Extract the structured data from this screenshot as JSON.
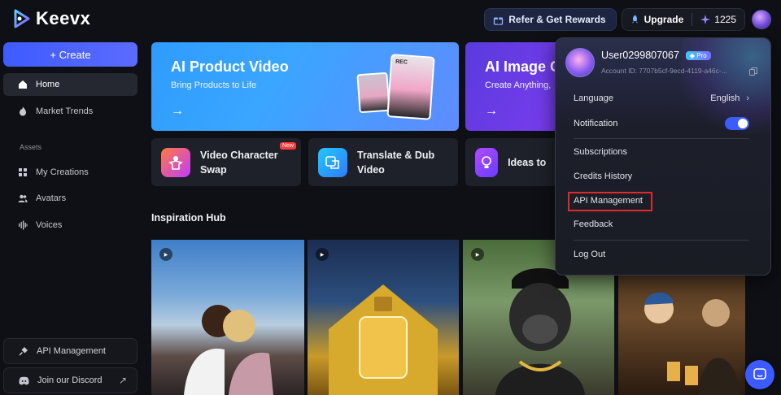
{
  "app": {
    "name": "Keevx"
  },
  "topbar": {
    "refer_label": "Refer & Get Rewards",
    "upgrade_label": "Upgrade",
    "credits": "1225"
  },
  "sidebar": {
    "create_label": "+ Create",
    "items": [
      {
        "label": "Home",
        "icon": "home-icon",
        "active": true
      },
      {
        "label": "Market Trends",
        "icon": "flame-icon",
        "active": false
      }
    ],
    "section_label": "Assets",
    "asset_items": [
      {
        "label": "My Creations",
        "icon": "grid-icon"
      },
      {
        "label": "Avatars",
        "icon": "users-icon"
      },
      {
        "label": "Voices",
        "icon": "waveform-icon"
      }
    ],
    "api_label": "API Management",
    "discord_label": "Join our Discord"
  },
  "main": {
    "hero_cards": [
      {
        "title": "AI Product Video",
        "subtitle": "Bring Products to Life",
        "arrow": "→",
        "photo_tag": "REC"
      },
      {
        "title": "AI Image G",
        "subtitle": "Create Anything,",
        "arrow": "→"
      }
    ],
    "tools": [
      {
        "label": "Video Character Swap",
        "badge": "New"
      },
      {
        "label": "Translate & Dub Video"
      },
      {
        "label": "Ideas to"
      }
    ],
    "hub_title": "Inspiration Hub"
  },
  "user_menu": {
    "username": "User0299807067",
    "plan_badge": "Pro",
    "account_id": "Account ID: 7707b5cf-9ecd-4119-a46c-...",
    "language_label": "Language",
    "language_value": "English",
    "notification_label": "Notification",
    "notification_on": true,
    "items": [
      "Subscriptions",
      "Credits History",
      "API Management",
      "Feedback"
    ],
    "logout_label": "Log Out"
  },
  "colors": {
    "accent": "#3d5cff",
    "background": "#0e1015",
    "highlight_box": "#e02a2a"
  }
}
